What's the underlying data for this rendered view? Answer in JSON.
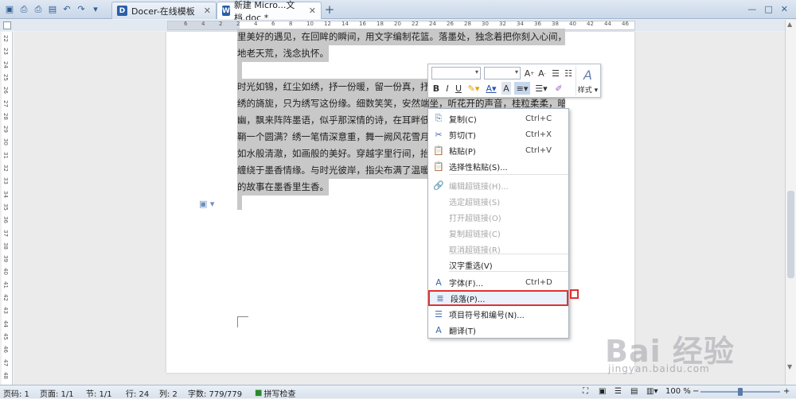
{
  "tabs": [
    {
      "icon_text": "D",
      "label": "Docer-在线模板",
      "color": "#2b5fa8"
    },
    {
      "icon_text": "W",
      "label": "新建 Micro...文档.doc *",
      "color": "#2b5fa8"
    }
  ],
  "window": {
    "minimize": "—",
    "maximize": "□",
    "close": "✕"
  },
  "ruler_numbers": [
    "6",
    "4",
    "2",
    "2",
    "4",
    "6",
    "8",
    "10",
    "12",
    "14",
    "16",
    "18",
    "20",
    "22",
    "24",
    "26",
    "28",
    "30",
    "32",
    "34",
    "36",
    "38",
    "40",
    "42",
    "44",
    "46"
  ],
  "vruler_numbers": [
    "22",
    "23",
    "24",
    "25",
    "26",
    "27",
    "28",
    "29",
    "30",
    "31",
    "32",
    "33",
    "34",
    "35",
    "36",
    "37",
    "38",
    "39",
    "40",
    "41",
    "42",
    "43",
    "44",
    "45",
    "46",
    "47",
    "48"
  ],
  "document": {
    "lines": [
      "里美好的遇见，在回眸的瞬间，用文字编制花篮。落墨处，独念着把你刻入心间，与墨",
      "地老天荒，浅念执怀。",
      "",
      "    时光如锦，红尘如绣，抒一份暖，留一份真，抒",
      "绣的旖旎，只为绣写这份缘。细数笑笑，安然端坐，听花开的声音，桂粒柔柔，暗香幽",
      "幽，飘来阵阵墨语，似乎那深情的诗，在耳畔低语",
      "鞘一个圆满？绣一笔情深意重，舞一阙风花雪月，",
      "如水般清澈，如画般的美好。穿越字里行间，抬，一",
      "缠绕于墨香情缘。与时光彼岸，指尖布满了温暖与",
      "的故事在墨香里生香。"
    ]
  },
  "mini_toolbar": {
    "font_value": "",
    "size_value": "",
    "bold": "B",
    "italic": "I",
    "underline": "U",
    "style_label": "样式"
  },
  "context_menu": {
    "items": [
      {
        "label": "复制(C)",
        "shortcut": "Ctrl+C",
        "icon": "copy-icon",
        "glyph": "⎘",
        "disabled": false
      },
      {
        "label": "剪切(T)",
        "shortcut": "Ctrl+X",
        "icon": "cut-icon",
        "glyph": "✂",
        "disabled": false
      },
      {
        "label": "粘贴(P)",
        "shortcut": "Ctrl+V",
        "icon": "paste-icon",
        "glyph": "📋",
        "disabled": false
      },
      {
        "label": "选择性粘贴(S)...",
        "shortcut": "",
        "icon": "paste-special-icon",
        "glyph": "📋",
        "disabled": false
      },
      {
        "label": "编辑超链接(H)...",
        "shortcut": "",
        "icon": "hyperlink-icon",
        "glyph": "🔗",
        "disabled": true
      },
      {
        "label": "选定超链接(S)",
        "shortcut": "",
        "icon": "",
        "glyph": "",
        "disabled": true
      },
      {
        "label": "打开超链接(O)",
        "shortcut": "",
        "icon": "",
        "glyph": "",
        "disabled": true
      },
      {
        "label": "复制超链接(C)",
        "shortcut": "",
        "icon": "",
        "glyph": "",
        "disabled": true
      },
      {
        "label": "取消超链接(R)",
        "shortcut": "",
        "icon": "",
        "glyph": "",
        "disabled": true
      },
      {
        "label": "汉字重选(V)",
        "shortcut": "",
        "icon": "",
        "glyph": "",
        "disabled": false
      },
      {
        "label": "字体(F)...",
        "shortcut": "Ctrl+D",
        "icon": "font-icon",
        "glyph": "A",
        "disabled": false
      },
      {
        "label": "段落(P)...",
        "shortcut": "",
        "icon": "paragraph-icon",
        "glyph": "≣",
        "disabled": false,
        "highlighted": true
      },
      {
        "label": "项目符号和编号(N)...",
        "shortcut": "",
        "icon": "bullets-icon",
        "glyph": "☰",
        "disabled": false
      },
      {
        "label": "翻译(T)",
        "shortcut": "",
        "icon": "translate-icon",
        "glyph": "A",
        "disabled": false
      }
    ]
  },
  "statusbar": {
    "page_num": "页码: 1",
    "pages": "页面: 1/1",
    "section": "节: 1/1",
    "row": "行: 24",
    "col": "列: 2",
    "word_count": "字数: 779/779",
    "spell_check": "拼写检查",
    "zoom": "100 %"
  },
  "watermark": {
    "top": "Bai 经验",
    "bottom": "jingyan.baidu.com"
  }
}
